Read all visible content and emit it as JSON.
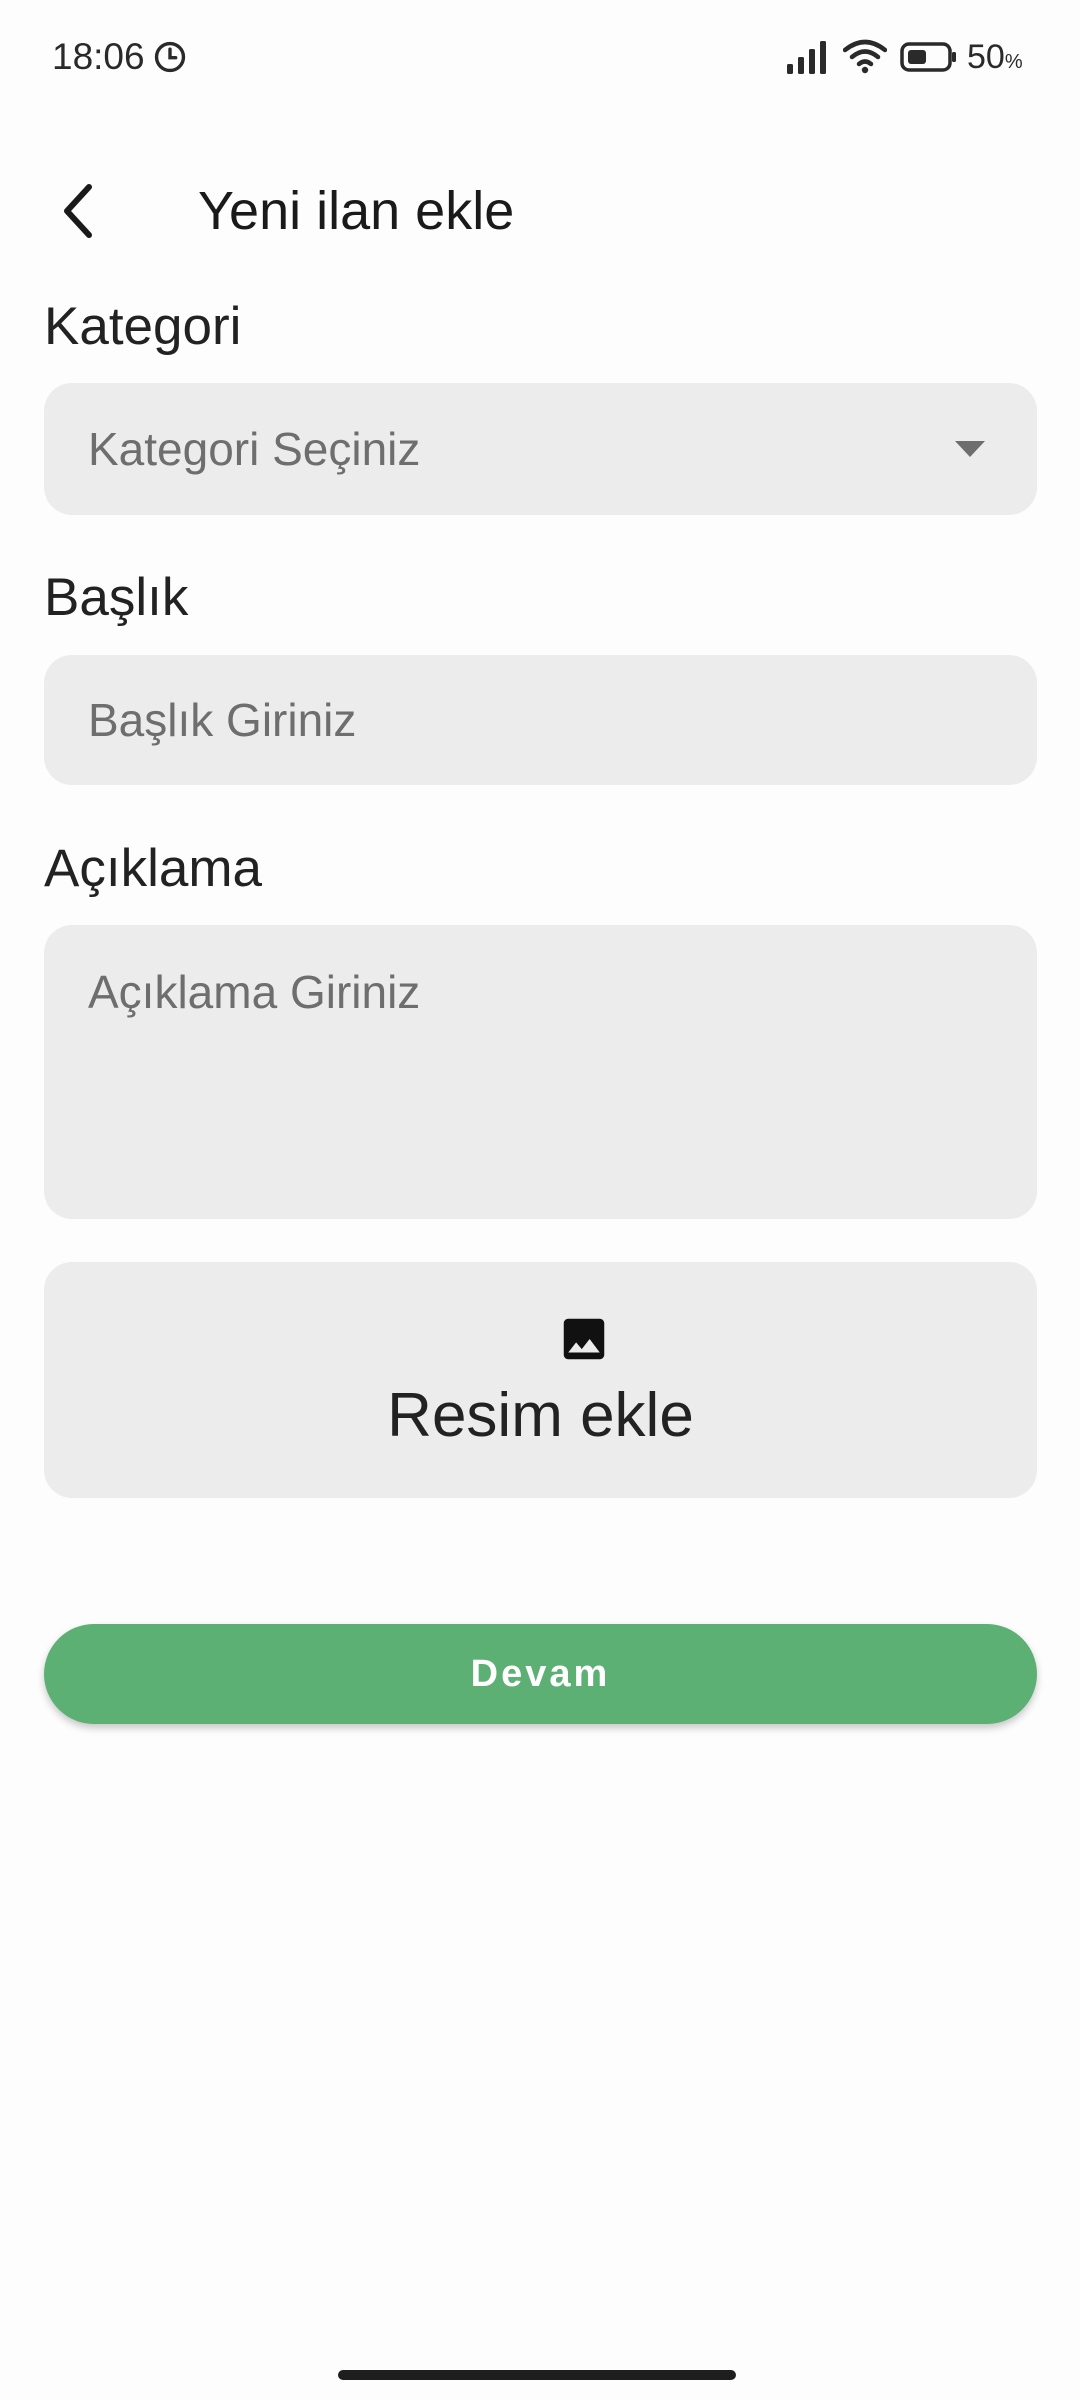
{
  "status_bar": {
    "time": "18:06",
    "battery_percent": "50",
    "battery_unit": "%",
    "icons": [
      "clock-icon",
      "signal-icon",
      "wifi-icon",
      "battery-icon"
    ]
  },
  "header": {
    "title": "Yeni ilan ekle",
    "back_icon": "chevron-left-icon"
  },
  "form": {
    "category": {
      "label": "Kategori",
      "placeholder": "Kategori Seçiniz"
    },
    "title_field": {
      "label": "Başlık",
      "placeholder": "Başlık Giriniz"
    },
    "description": {
      "label": "Açıklama",
      "placeholder": "Açıklama Giriniz"
    },
    "add_image": {
      "label": "Resim ekle",
      "icon": "image-icon"
    },
    "continue_label": "Devam"
  },
  "colors": {
    "accent": "#5db073",
    "field_background": "#ececec",
    "placeholder": "#6e6e6e"
  }
}
